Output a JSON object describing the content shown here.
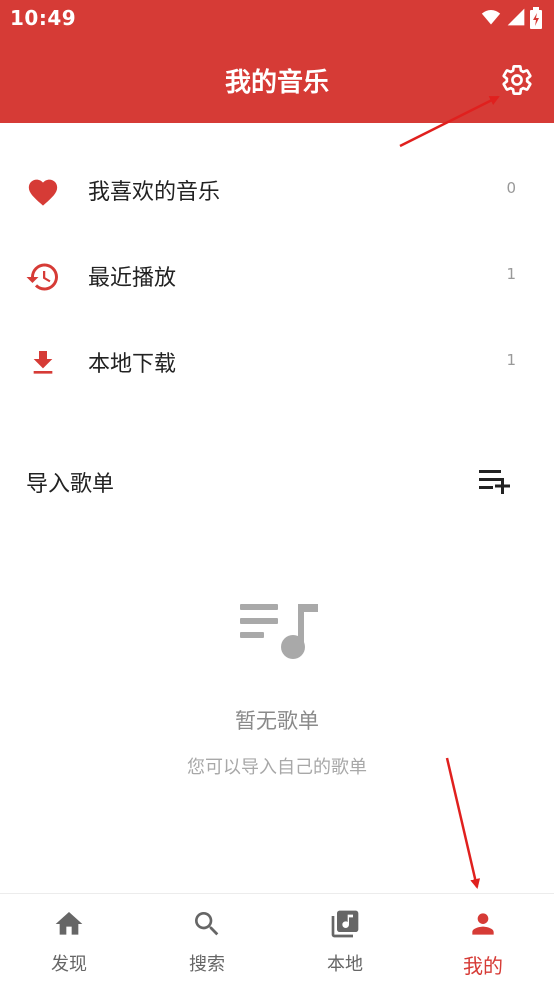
{
  "status_bar": {
    "time": "10:49"
  },
  "header": {
    "title": "我的音乐",
    "settings_icon": "gear-icon"
  },
  "menu": [
    {
      "label": "我喜欢的音乐",
      "count": "0",
      "icon": "heart-icon"
    },
    {
      "label": "最近播放",
      "count": "1",
      "icon": "history-icon"
    },
    {
      "label": "本地下载",
      "count": "1",
      "icon": "download-icon"
    }
  ],
  "playlists": {
    "title": "导入歌单",
    "import_icon": "playlist-add-icon",
    "empty_title": "暂无歌单",
    "empty_subtitle": "您可以导入自己的歌单"
  },
  "bottom_nav": [
    {
      "label": "发现",
      "icon": "home-icon",
      "active": false
    },
    {
      "label": "搜索",
      "icon": "search-icon",
      "active": false
    },
    {
      "label": "本地",
      "icon": "library-music-icon",
      "active": false
    },
    {
      "label": "我的",
      "icon": "person-icon",
      "active": true
    }
  ],
  "colors": {
    "accent": "#d63b36",
    "muted": "#999999"
  }
}
